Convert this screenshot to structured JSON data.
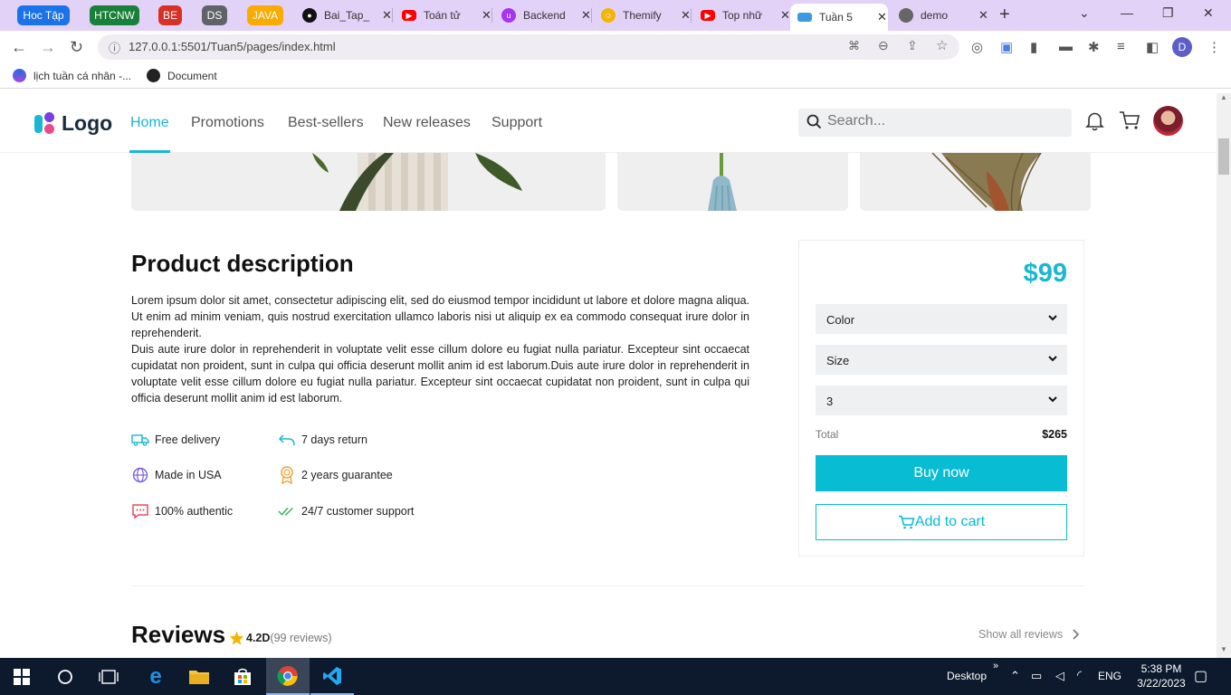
{
  "browser": {
    "tab_groups": [
      {
        "label": "Hoc Tập",
        "color": "#1a73e8"
      },
      {
        "label": "HTCNW",
        "color": "#188038"
      },
      {
        "label": "BE",
        "color": "#d93025"
      },
      {
        "label": "DS",
        "color": "#5f6368"
      },
      {
        "label": "JAVA",
        "color": "#f9ab00"
      }
    ],
    "tabs": [
      {
        "title": "Bai_Tap_",
        "icon": "github-icon",
        "color": "#111111"
      },
      {
        "title": "Toán tử",
        "icon": "youtube-icon",
        "color": "#ff0000"
      },
      {
        "title": "Backend",
        "icon": "udemy-icon",
        "color": "#a435f0"
      },
      {
        "title": "Themify",
        "icon": "emoji-icon",
        "color": "#f5b400"
      },
      {
        "title": "Top nhữ",
        "icon": "youtube-icon",
        "color": "#ff0000"
      },
      {
        "title": "Tuần 5",
        "icon": "vscode-live-icon",
        "color": "#3b9ae1",
        "active": true
      },
      {
        "title": "demo",
        "icon": "globe-icon",
        "color": "#666666"
      }
    ],
    "url": "127.0.0.1:5501/Tuan5/pages/index.html",
    "profile_initial": "D",
    "bookmarks": [
      {
        "label": "lịch tuần cá nhân -...",
        "icon": "calendar-icon"
      },
      {
        "label": "Document",
        "icon": "globe-icon"
      }
    ]
  },
  "site": {
    "logo_text": "Logo",
    "nav": [
      "Home",
      "Promotions",
      "Best-sellers",
      "New releases",
      "Support"
    ],
    "active_nav": "Home",
    "search_placeholder": "Search...",
    "accent": "#1ab8d0"
  },
  "product": {
    "description_title": "Product description",
    "description_p1": "Lorem ipsum dolor sit amet, consectetur adipiscing elit, sed do eiusmod tempor incididunt ut labore et dolore magna aliqua. Ut enim ad minim veniam, quis nostrud exercitation ullamco laboris nisi ut aliquip ex ea commodo consequat irure dolor in reprehenderit.",
    "description_p2": "Duis aute irure dolor in reprehenderit in voluptate velit esse cillum dolore eu fugiat nulla pariatur. Excepteur sint occaecat cupidatat non proident, sunt in culpa qui officia deserunt mollit anim id est laborum.Duis aute irure dolor in reprehenderit in voluptate velit esse cillum dolore eu fugiat nulla pariatur. Excepteur sint occaecat cupidatat non proident, sunt in culpa qui officia deserunt mollit anim id est laborum.",
    "features": [
      {
        "label": "Free delivery",
        "icon": "truck-icon"
      },
      {
        "label": "7 days return",
        "icon": "return-arrow-icon"
      },
      {
        "label": "Made in USA",
        "icon": "globe-icon"
      },
      {
        "label": "2 years guarantee",
        "icon": "award-icon"
      },
      {
        "label": "100% authentic",
        "icon": "message-icon"
      },
      {
        "label": "24/7 customer support",
        "icon": "double-check-icon"
      }
    ],
    "price": "$99",
    "color_select": "Color",
    "size_select": "Size",
    "quantity_select": "3",
    "total_label": "Total",
    "total_value": "$265",
    "buy_now": "Buy now",
    "add_to_cart": "Add to cart"
  },
  "reviews": {
    "title": "Reviews",
    "rating": "4.2D",
    "count": "(99 reviews)",
    "show_all": "Show all reviews"
  },
  "taskbar": {
    "desktop_label": "Desktop",
    "language": "ENG",
    "time": "5:38 PM",
    "date": "3/22/2023"
  }
}
